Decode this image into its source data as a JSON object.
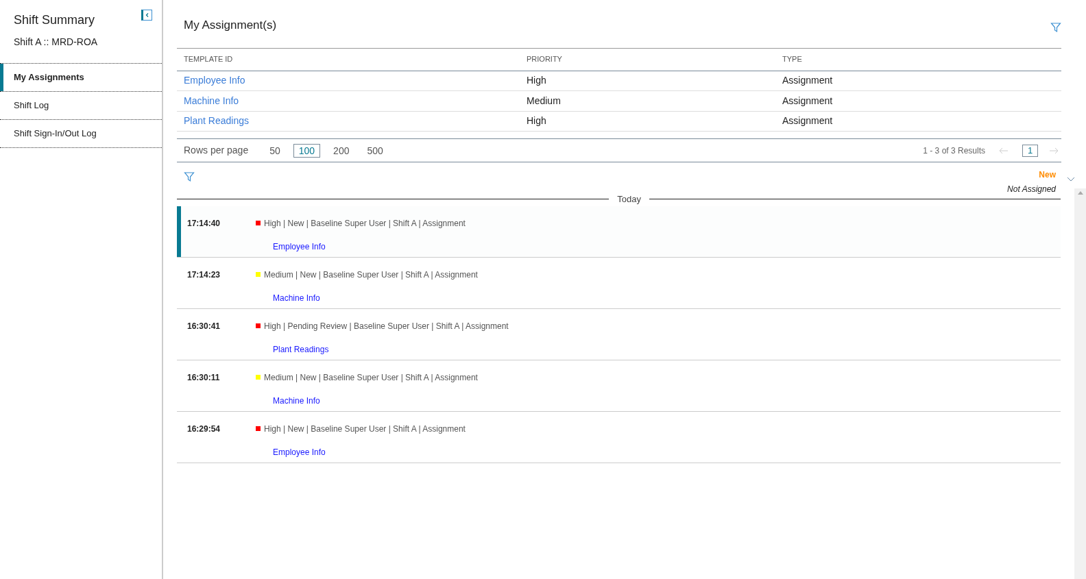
{
  "sidebar": {
    "title": "Shift Summary",
    "subtitle": "Shift A :: MRD-ROA",
    "items": [
      {
        "label": "My Assignments",
        "selected": true
      },
      {
        "label": "Shift Log",
        "selected": false
      },
      {
        "label": "Shift Sign-In/Out Log",
        "selected": false
      }
    ]
  },
  "assignments": {
    "title": "My Assignment(s)",
    "columns": [
      "TEMPLATE ID",
      "PRIORITY",
      "TYPE"
    ],
    "rows": [
      [
        "Employee Info",
        "High",
        "Assignment"
      ],
      [
        "Machine Info",
        "Medium",
        "Assignment"
      ],
      [
        "Plant Readings",
        "High",
        "Assignment"
      ]
    ],
    "pagination": {
      "label": "Rows per page",
      "options": [
        {
          "label": "50",
          "selected": false
        },
        {
          "label": "100",
          "selected": true
        },
        {
          "label": "200",
          "selected": false
        },
        {
          "label": "500",
          "selected": false
        }
      ],
      "results": "1 - 3 of 3 Results",
      "page": "1"
    }
  },
  "feed": {
    "status": "New",
    "assignee": "Not Assigned",
    "day": "Today",
    "entries": [
      {
        "time": "17:14:40",
        "color": "#ff0000",
        "meta": "High | New | Baseline Super User | Shift A | Assignment",
        "link": "Employee Info",
        "selected": true
      },
      {
        "time": "17:14:23",
        "color": "#ffff00",
        "meta": "Medium | New | Baseline Super User | Shift A | Assignment",
        "link": "Machine Info",
        "selected": false
      },
      {
        "time": "16:30:41",
        "color": "#ff0000",
        "meta": "High | Pending Review | Baseline Super User | Shift A | Assignment",
        "link": "Plant Readings",
        "selected": false
      },
      {
        "time": "16:30:11",
        "color": "#ffff00",
        "meta": "Medium | New | Baseline Super User | Shift A | Assignment",
        "link": "Machine Info",
        "selected": false
      },
      {
        "time": "16:29:54",
        "color": "#ff0000",
        "meta": "High | New | Baseline Super User | Shift A | Assignment",
        "link": "Employee Info",
        "selected": false
      }
    ]
  }
}
